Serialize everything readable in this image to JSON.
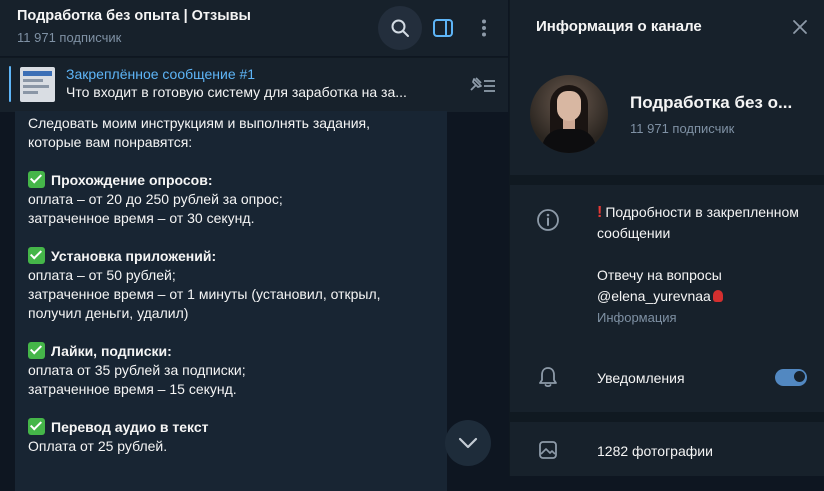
{
  "chat": {
    "title": "Подработка без опыта | Отзывы",
    "subscribers": "11 971 подписчик"
  },
  "pinned": {
    "title": "Закреплённое сообщение #1",
    "text": "Что входит в готовую систему для заработка на за..."
  },
  "message": {
    "intro_line1": "Следовать моим инструкциям и выполнять задания,",
    "intro_line2": "которые вам понравятся:",
    "items": [
      {
        "heading": "Прохождение опросов:",
        "lines": [
          "оплата –  от 20 до 250 рублей за опрос;",
          "затраченное время – от 30 секунд."
        ]
      },
      {
        "heading": "Установка приложений:",
        "lines": [
          "оплата – от 50 рублей;",
          "затраченное время – от 1 минуты (установил, открыл,",
          "получил деньги, удалил)"
        ]
      },
      {
        "heading": "Лайки, подписки:",
        "lines": [
          "оплата от 35 рублей за подписки;",
          "затраченное время – 15 секунд."
        ]
      },
      {
        "heading": "Перевод аудио в текст",
        "lines": [
          "Оплата от 25 рублей."
        ]
      }
    ]
  },
  "info_panel": {
    "title": "Информация о канале",
    "channel_name": "Подработка без о...",
    "subscribers": "11 971 подписчик",
    "description_line1": "Подробности в закрепленном сообщении",
    "description_line2": "Отвечу на вопросы @elena_yurevnaa",
    "description_label": "Информация",
    "notifications_label": "Уведомления",
    "notifications_enabled": true,
    "photos_label": "1282 фотографии"
  },
  "colors": {
    "accent": "#5eb5f7",
    "panel_bg": "#17212b",
    "chat_bg": "#0e1621",
    "bubble_bg": "#182533",
    "check": "#45b649",
    "toggle": "#5288c1"
  },
  "icons": [
    "search-icon",
    "sidebar-toggle-icon",
    "more-vertical-icon",
    "pinned-list-icon",
    "chevron-down-icon",
    "close-icon",
    "info-icon",
    "bell-icon",
    "photo-icon",
    "check-mark-icon",
    "exclamation-icon",
    "rose-icon"
  ]
}
